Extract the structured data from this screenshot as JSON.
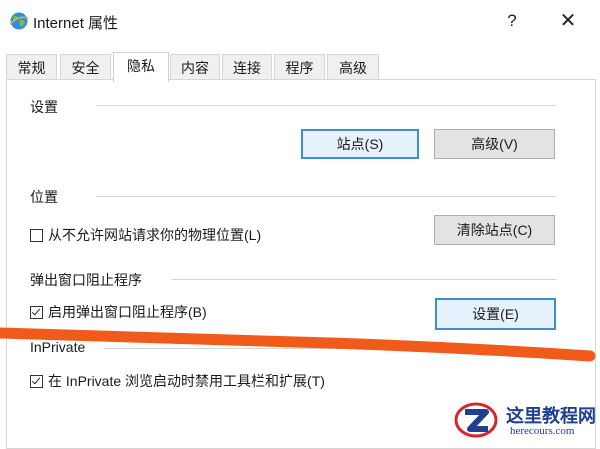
{
  "window": {
    "title": "Internet 属性",
    "help_label": "?",
    "close_label": "✕",
    "app_icon": "internet-options-globe-icon"
  },
  "tabs": [
    {
      "label": "常规",
      "active": false
    },
    {
      "label": "安全",
      "active": false
    },
    {
      "label": "隐私",
      "active": true
    },
    {
      "label": "内容",
      "active": false
    },
    {
      "label": "连接",
      "active": false
    },
    {
      "label": "程序",
      "active": false
    },
    {
      "label": "高级",
      "active": false
    }
  ],
  "settings_group": {
    "label": "设置",
    "sites_button": "站点(S)",
    "advanced_button": "高级(V)"
  },
  "location_group": {
    "label": "位置",
    "checkbox_label": "从不允许网站请求你的物理位置(L)",
    "checked": false,
    "clear_sites_button": "清除站点(C)"
  },
  "popup_group": {
    "label": "弹出窗口阻止程序",
    "checkbox_label": "启用弹出窗口阻止程序(B)",
    "checked": true,
    "settings_button": "设置(E)"
  },
  "inprivate_group": {
    "label": "InPrivate",
    "checkbox_label": "在 InPrivate 浏览启动时禁用工具栏和扩展(T)",
    "checked": true
  },
  "annotation": {
    "stroke_color": "#f05a1a"
  },
  "watermark": {
    "title": "这里教程网",
    "subtitle": "herecours.com",
    "brand_color": "#1f3f8f",
    "accent_color": "#d6262a"
  }
}
